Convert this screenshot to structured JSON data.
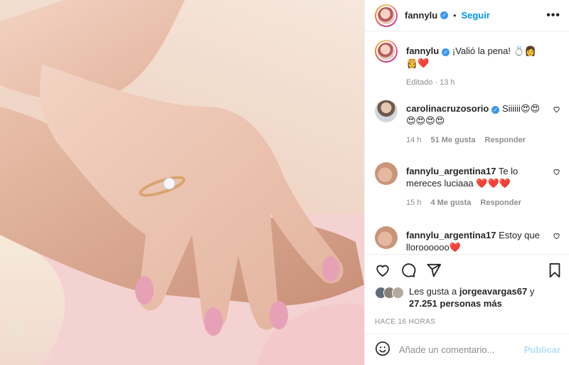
{
  "header": {
    "username": "fannylu",
    "follow_label": "Seguir",
    "dot": "•",
    "more": "•••"
  },
  "caption": {
    "username": "fannylu",
    "text": "¡Valió la pena! 💍👩👸❤️",
    "edited": "Editado",
    "time": "13 h"
  },
  "comments": [
    {
      "username": "carolinacruzosorio",
      "verified": true,
      "text": "Siiiiii😍😍😍😍😍😍",
      "time": "14 h",
      "likes": "51 Me gusta",
      "reply": "Responder"
    },
    {
      "username": "fannylu_argentina17",
      "verified": false,
      "text": "Te lo mereces luciaaa ❤️❤️❤️",
      "time": "15 h",
      "likes": "4 Me gusta",
      "reply": "Responder"
    },
    {
      "username": "fannylu_argentina17",
      "verified": false,
      "text": "Estoy que lloroooooo❤️",
      "time": "",
      "likes": "",
      "reply": ""
    }
  ],
  "likes": {
    "prefix": "Les gusta a",
    "user": "jorgeavargas67",
    "conj": "y",
    "count": "27.251 personas más"
  },
  "timestamp": "HACE 16 HORAS",
  "add_comment": {
    "placeholder": "Añade un comentario...",
    "publish": "Publicar"
  },
  "icons": {
    "like": "heart-icon",
    "comment": "comment-icon",
    "share": "share-icon",
    "save": "bookmark-icon",
    "emoji": "emoji-icon",
    "more": "more-icon"
  },
  "colors": {
    "accent": "#0095f6",
    "verified": "#3897f0",
    "publish_disabled": "#b2dffc",
    "muted": "#8e8e8e"
  }
}
